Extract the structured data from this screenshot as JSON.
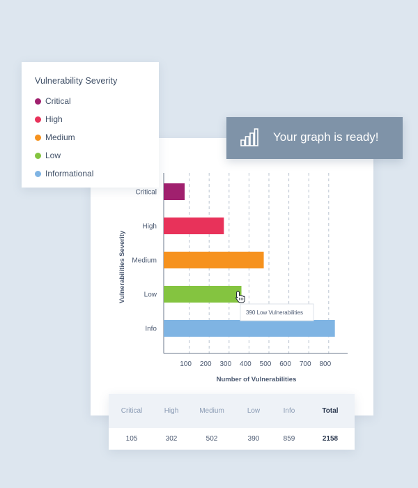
{
  "legend": {
    "title": "Vulnerability Severity",
    "items": [
      {
        "label": "Critical",
        "color": "#a0206e"
      },
      {
        "label": "High",
        "color": "#e8325a"
      },
      {
        "label": "Medium",
        "color": "#f6921e"
      },
      {
        "label": "Low",
        "color": "#84c440"
      },
      {
        "label": "Informational",
        "color": "#7fb4e3"
      }
    ]
  },
  "toast": {
    "message": "Your graph is ready!",
    "icon": "bar-chart-icon"
  },
  "chart_data": {
    "type": "bar",
    "orientation": "horizontal",
    "categories": [
      "Critical",
      "High",
      "Medium",
      "Low",
      "Info"
    ],
    "values": [
      105,
      302,
      502,
      390,
      859
    ],
    "colors": [
      "#a0206e",
      "#e8325a",
      "#f6921e",
      "#84c440",
      "#7fb4e3"
    ],
    "xlabel": "Number of Vulnerabilities",
    "ylabel": "Vulnerabilities Severity",
    "xticks": [
      100,
      200,
      300,
      400,
      500,
      600,
      700,
      800
    ],
    "grid": "vertical-dashed",
    "tooltip": {
      "category": "Low",
      "text": "390 Low Vulnerabilities"
    }
  },
  "summary": {
    "headers": [
      "Critical",
      "High",
      "Medium",
      "Low",
      "Info",
      "Total"
    ],
    "values": [
      "105",
      "302",
      "502",
      "390",
      "859",
      "2158"
    ]
  }
}
